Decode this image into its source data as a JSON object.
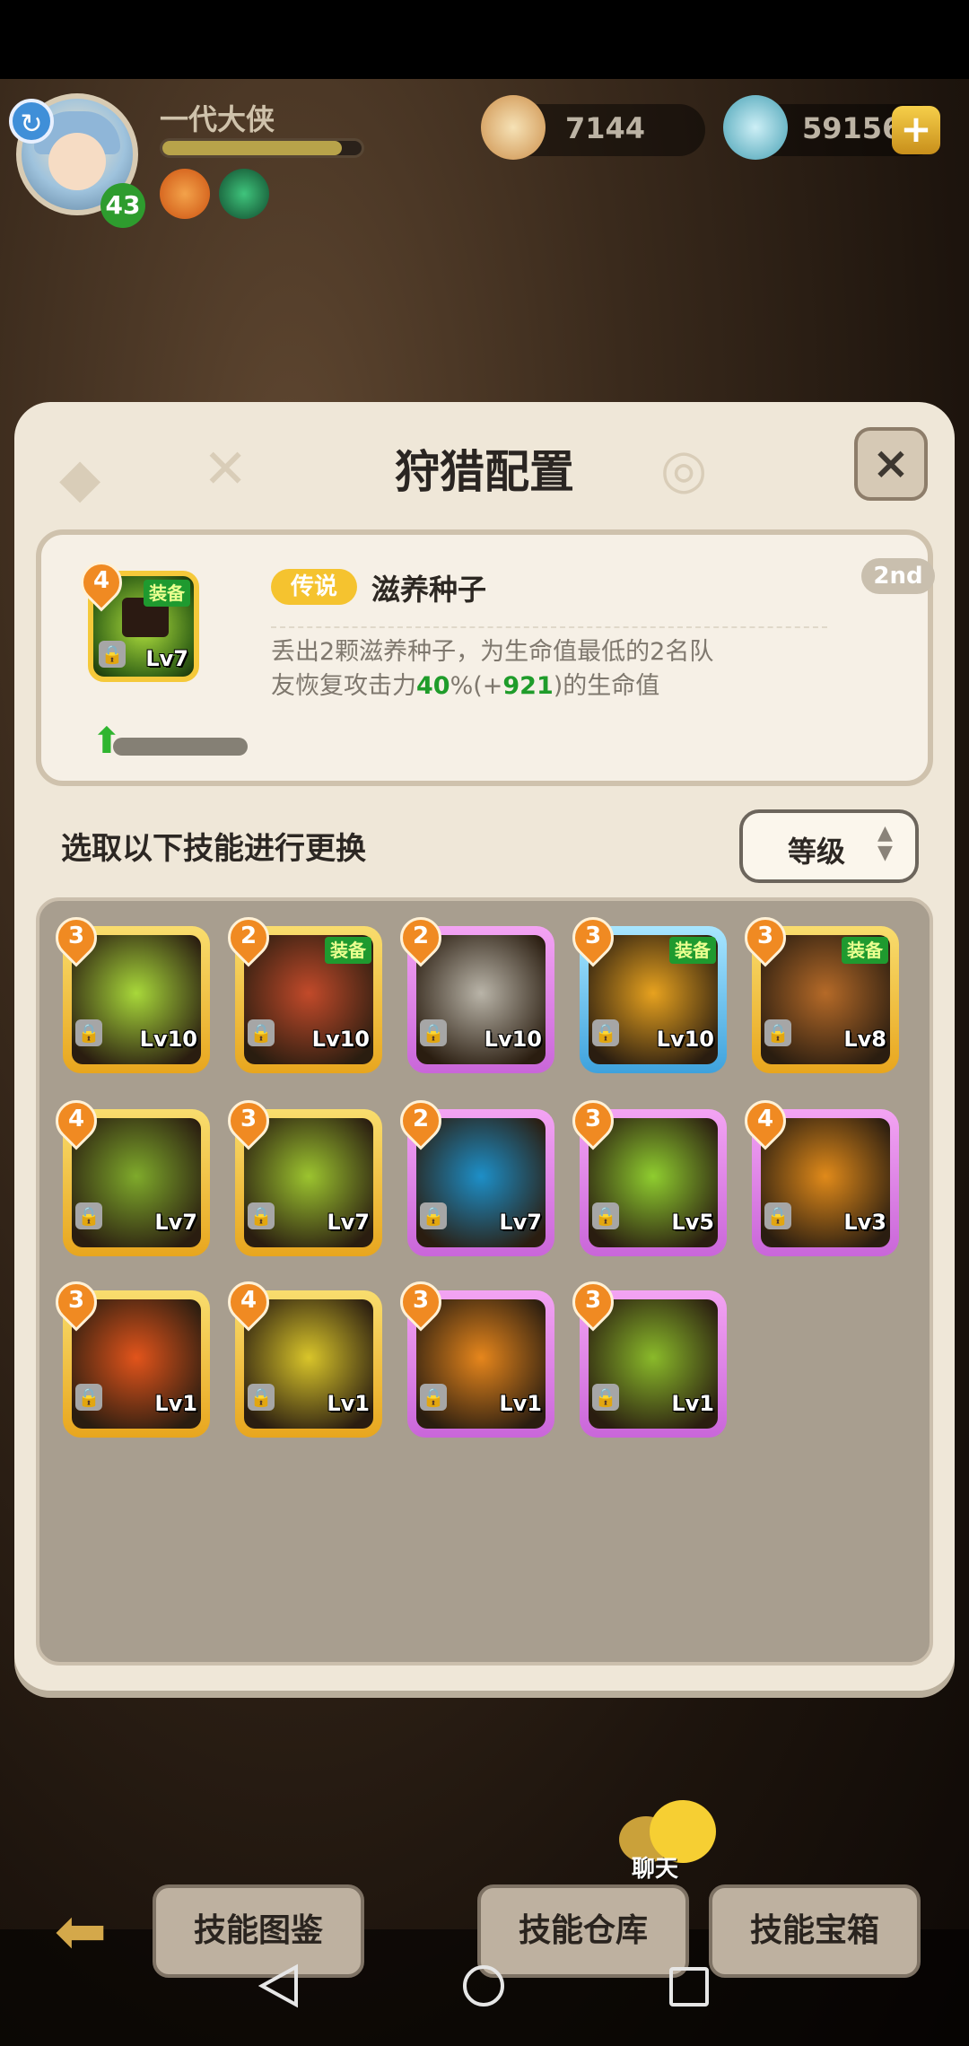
{
  "player": {
    "name": "一代大侠",
    "level": "43",
    "xp_fraction": 0.9
  },
  "currencies": [
    {
      "name": "shell",
      "value": "7144"
    },
    {
      "name": "pearl",
      "value": "59156"
    }
  ],
  "dialog": {
    "title": "狩猎配置",
    "close": "×",
    "selected": {
      "rarity": "传说",
      "name": "滋养种子",
      "rank": "2nd",
      "count": "4",
      "equip_tag": "装备",
      "level": "Lv7",
      "desc_a": "丢出2颗滋养种子，为生命值最低的2名队",
      "desc_b": "友恢复攻击力",
      "desc_pct": "40",
      "desc_c": "%(+",
      "desc_bonus": "921",
      "desc_d": ")的生命值",
      "progress_fraction": 0.0
    },
    "prompt": "选取以下技能进行更换",
    "sort_label": "等级",
    "skills": [
      {
        "count": "3",
        "level": "Lv10",
        "frame": "gold",
        "equipped": false,
        "color": "#a8d83a"
      },
      {
        "count": "2",
        "level": "Lv10",
        "frame": "gold",
        "equipped": true,
        "color": "#c24a2a"
      },
      {
        "count": "2",
        "level": "Lv10",
        "frame": "purple",
        "equipped": false,
        "color": "#b9b4a8"
      },
      {
        "count": "3",
        "level": "Lv10",
        "frame": "blue",
        "equipped": true,
        "color": "#e7a21f"
      },
      {
        "count": "3",
        "level": "Lv8",
        "frame": "gold",
        "equipped": true,
        "color": "#b56a28"
      },
      {
        "count": "4",
        "level": "Lv7",
        "frame": "gold",
        "equipped": false,
        "color": "#7faa2b"
      },
      {
        "count": "3",
        "level": "Lv7",
        "frame": "gold",
        "equipped": false,
        "color": "#9cc42f"
      },
      {
        "count": "2",
        "level": "Lv7",
        "frame": "purple",
        "equipped": false,
        "color": "#1d8fc8"
      },
      {
        "count": "3",
        "level": "Lv5",
        "frame": "purple",
        "equipped": false,
        "color": "#8fcd2f"
      },
      {
        "count": "4",
        "level": "Lv3",
        "frame": "purple",
        "equipped": false,
        "color": "#e08a1a"
      },
      {
        "count": "3",
        "level": "Lv1",
        "frame": "gold",
        "equipped": false,
        "color": "#e2541b"
      },
      {
        "count": "4",
        "level": "Lv1",
        "frame": "gold",
        "equipped": false,
        "color": "#d9c52a"
      },
      {
        "count": "3",
        "level": "Lv1",
        "frame": "purple",
        "equipped": false,
        "color": "#e6861c"
      },
      {
        "count": "3",
        "level": "Lv1",
        "frame": "purple",
        "equipped": false,
        "color": "#8aba2a"
      }
    ],
    "equip_tag": "装备"
  },
  "bottom": {
    "buttons": [
      "技能图鉴",
      "技能仓库",
      "技能宝箱"
    ],
    "chat_label": "聊天"
  },
  "icons": [
    "back-badge-icon",
    "shell-currency-icon",
    "pearl-currency-icon",
    "plus-icon",
    "close-icon",
    "lock-icon",
    "sort-arrows-icon",
    "back-arrow-icon",
    "chat-icon",
    "nav-back-icon",
    "nav-home-icon",
    "nav-recent-icon"
  ]
}
